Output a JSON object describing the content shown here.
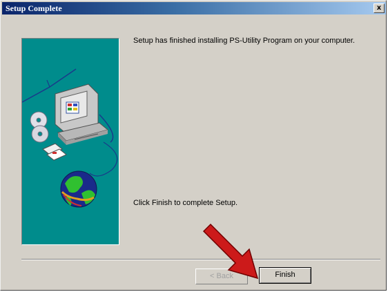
{
  "window": {
    "title": "Setup Complete",
    "close_label": "x"
  },
  "main": {
    "message_top": "Setup has finished installing PS-Utility Program on your computer.",
    "message_bottom": "Click Finish to complete Setup."
  },
  "buttons": {
    "back_label": "< Back",
    "finish_label": "Finish"
  },
  "annotation": {
    "arrow_color": "#cc1a1a",
    "icon": "red-arrow-icon"
  },
  "colors": {
    "dialog_bg": "#d4d0c8",
    "title_bar_start": "#0a246a",
    "side_panel": "#008c8c"
  }
}
